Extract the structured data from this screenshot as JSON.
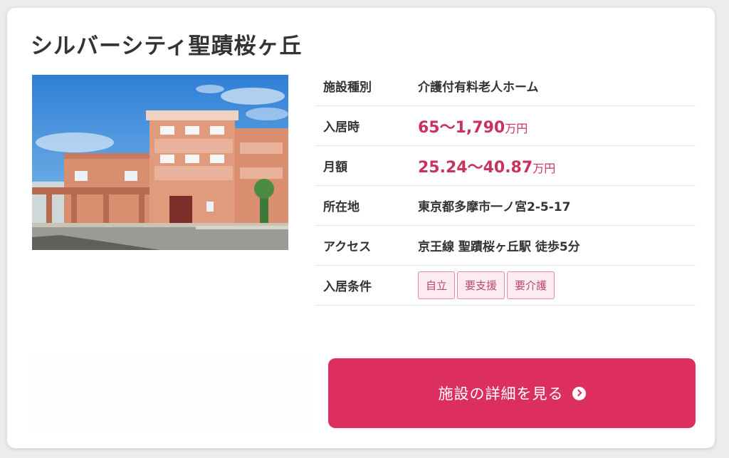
{
  "facility": {
    "name": "シルバーシティ聖蹟桜ヶ丘"
  },
  "info": {
    "type_label": "施設種別",
    "type_value": "介護付有料老人ホーム",
    "entry_fee_label": "入居時",
    "entry_fee_value": "65〜1,790",
    "entry_fee_unit": "万円",
    "monthly_label": "月額",
    "monthly_value": "25.24〜40.87",
    "monthly_unit": "万円",
    "address_label": "所在地",
    "address_value": "東京都多摩市一ノ宮2-5-17",
    "access_label": "アクセス",
    "access_value": "京王線 聖蹟桜ヶ丘駅 徒歩5分",
    "conditions_label": "入居条件",
    "conditions": [
      "自立",
      "要支援",
      "要介護"
    ]
  },
  "detail_button": {
    "label": "施設の詳細を見る",
    "icon": "circle-chevron-right-icon"
  },
  "colors": {
    "accent": "#dc2f60",
    "price": "#c8335e",
    "tag_bg": "#fcebf1",
    "tag_border": "#e58aa6"
  }
}
